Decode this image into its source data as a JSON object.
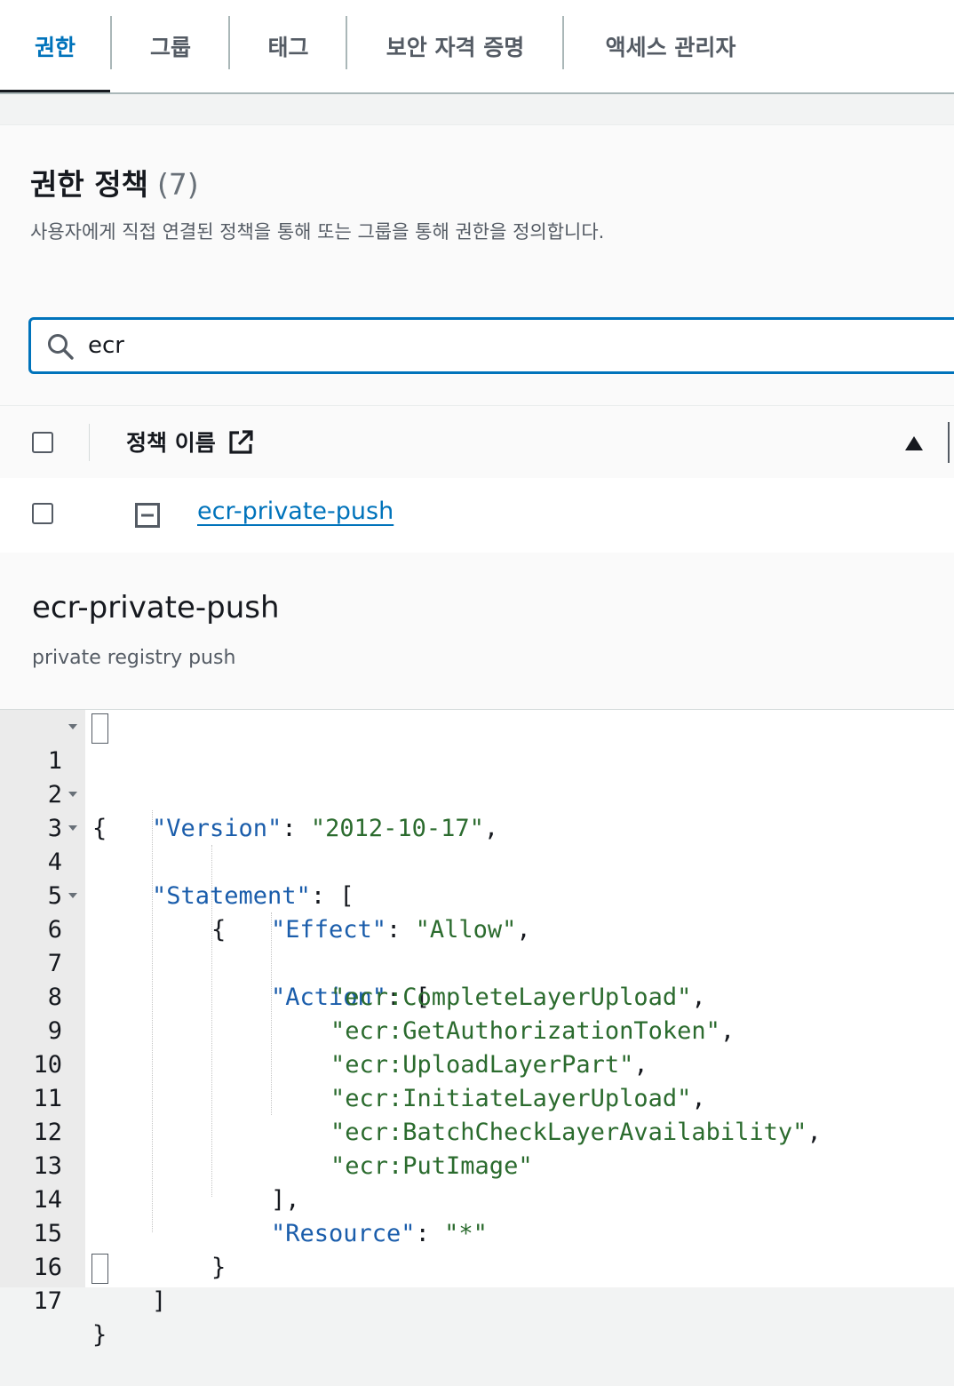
{
  "tabs": [
    {
      "label": "권한",
      "active": true
    },
    {
      "label": "그룹",
      "active": false
    },
    {
      "label": "태그",
      "active": false
    },
    {
      "label": "보안 자격 증명",
      "active": false
    },
    {
      "label": "액세스 관리자",
      "active": false
    }
  ],
  "panel": {
    "title": "권한 정책",
    "count": "(7)",
    "description": "사용자에게 직접 연결된 정책을 통해 또는 그룹을 통해 권한을 정의합니다."
  },
  "search": {
    "value": "ecr"
  },
  "table": {
    "column_header": "정책 이름",
    "rows": [
      {
        "name": "ecr-private-push"
      }
    ]
  },
  "detail": {
    "title": "ecr-private-push",
    "description": "private registry push"
  },
  "editor": {
    "line_numbers": [
      "1",
      "2",
      "3",
      "4",
      "5",
      "6",
      "7",
      "8",
      "9",
      "10",
      "11",
      "12",
      "13",
      "14",
      "15",
      "16",
      "17"
    ],
    "tokens": {
      "open_brace": "{",
      "version_key": "\"Version\"",
      "version_value": "\"2012-10-17\"",
      "statement_key": "\"Statement\"",
      "open_bracket": "[",
      "inner_open_brace": "{",
      "effect_key": "\"Effect\"",
      "effect_value": "\"Allow\"",
      "action_key": "\"Action\"",
      "actions": [
        "\"ecr:CompleteLayerUpload\"",
        "\"ecr:GetAuthorizationToken\"",
        "\"ecr:UploadLayerPart\"",
        "\"ecr:InitiateLayerUpload\"",
        "\"ecr:BatchCheckLayerAvailability\"",
        "\"ecr:PutImage\""
      ],
      "close_bracket_comma": "],",
      "resource_key": "\"Resource\"",
      "resource_value": "\"*\"",
      "inner_close_brace": "}",
      "close_bracket": "]",
      "close_brace": "}"
    }
  },
  "colors": {
    "accent": "#0073bb",
    "json_key": "#1a5dab",
    "json_string": "#2b6b2e"
  }
}
